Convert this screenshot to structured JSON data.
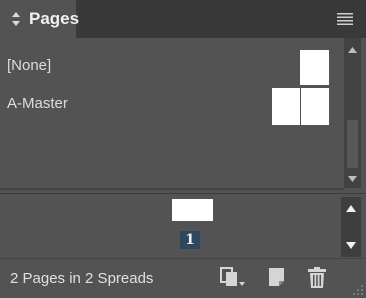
{
  "panel": {
    "tab_label": "Pages",
    "menu_icon": "panel-menu-icon"
  },
  "masters": [
    {
      "label": "[None]",
      "thumb": "single-page"
    },
    {
      "label": "A-Master",
      "thumb": "spread"
    }
  ],
  "pages": {
    "page_number": "1"
  },
  "status": {
    "text": "2 Pages in 2 Spreads",
    "icons": [
      "edit-page-size-icon",
      "new-page-icon",
      "trash-icon",
      "resize-grip-icon"
    ]
  },
  "colors": {
    "panel_bg": "#535353",
    "tab_bar_bg": "#393939",
    "page_fill": "#ffffff",
    "page_number_badge": "#2e4660"
  }
}
